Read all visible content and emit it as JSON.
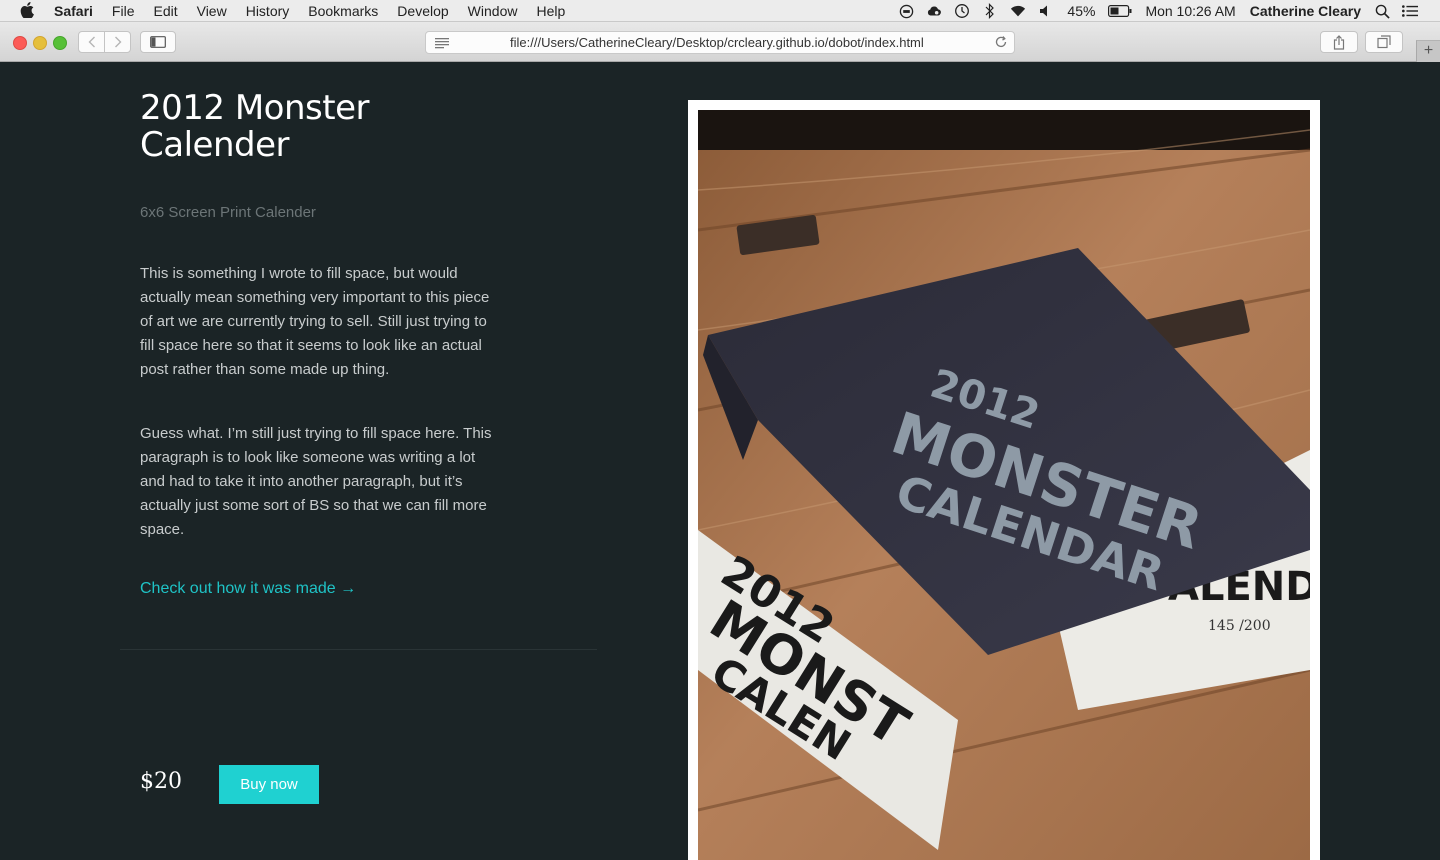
{
  "menubar": {
    "app": "Safari",
    "items": [
      "File",
      "Edit",
      "View",
      "History",
      "Bookmarks",
      "Develop",
      "Window",
      "Help"
    ],
    "battery": "45%",
    "clock": "Mon 10:26 AM",
    "user": "Catherine Cleary",
    "icons": [
      "apple-icon",
      "adblock-icon",
      "creative-cloud-icon",
      "time-machine-icon",
      "bluetooth-icon",
      "wifi-icon",
      "volume-icon",
      "battery-icon",
      "spotlight-icon",
      "notification-center-icon"
    ]
  },
  "browser": {
    "url": "file:///Users/CatherineCleary/Desktop/crcleary.github.io/dobot/index.html"
  },
  "product": {
    "title": "2012 Monster Calender",
    "subtitle": "6x6 Screen Print Calender",
    "paragraph_1": "This is something I wrote to fill space, but would actually mean something very important to this piece of art we are currently trying to sell. Still just trying to fill space here so that it seems to look like an actual post rather than some made up thing.",
    "paragraph_2": "Guess what. I’m still just trying to fill space here. This paragraph is to look like someone was writing a lot and had to take it into another paragraph, but it’s actually just some sort of BS so that we can fill more space.",
    "link": "Check out how it was made →",
    "price": "$20",
    "buy_label": "Buy now"
  },
  "photo": {
    "envelope_line_1": "2012",
    "envelope_line_2": "MONSTER",
    "envelope_line_3": "CALENDAR",
    "left_cal_line_1": "2012",
    "left_cal_line_2": "MONST",
    "left_cal_line_3": "CALEN",
    "right_cal_text": "ALEND",
    "edition": "145 /200"
  },
  "colors": {
    "background": "#1b2426",
    "accent": "#1fd1d1",
    "link": "#1fc3c6"
  }
}
